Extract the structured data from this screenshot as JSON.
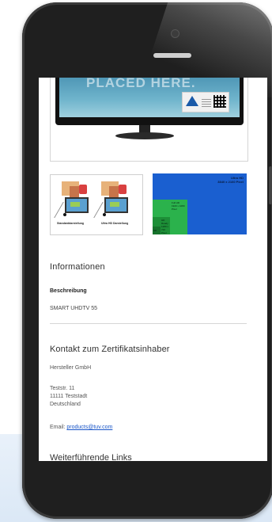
{
  "hero": {
    "monitor_text": "PLACED HERE."
  },
  "thumbnails": {
    "left_caption_1": "Standarddarstellung",
    "left_caption_2": "Ultra HD Darstellung",
    "right_label_line1": "Ultra HD",
    "right_label_line2": "3840 x 2160 Pixel",
    "right_full_hd_1": "Full HD",
    "right_full_hd_2": "1920 x 1080 Pixel",
    "right_hd_1": "HD Ready",
    "right_hd_2": "1280 x 720 Pixel",
    "right_sd": "SD"
  },
  "informationen": {
    "heading": "Informationen",
    "beschreibung_label": "Beschreibung",
    "beschreibung_value": "SMART UHDTV 55"
  },
  "kontakt": {
    "heading": "Kontakt zum Zertifikatsinhaber",
    "company": "Hersteller GmbH",
    "street": "Teststr. 11",
    "city": "11111 Teststadt",
    "country": "Deutschland",
    "email_label": "Email: ",
    "email": "products@tuv.com"
  },
  "more": {
    "heading": "Weiterführende Links"
  }
}
